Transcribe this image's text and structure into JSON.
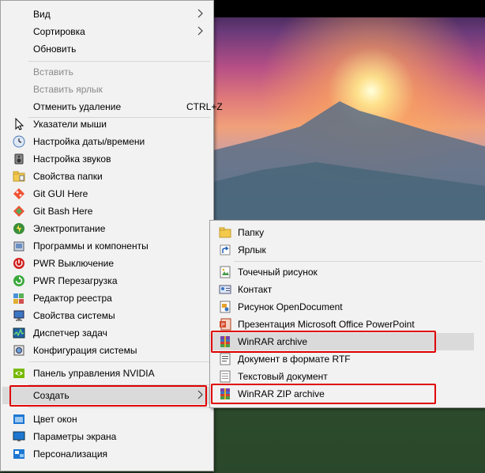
{
  "colors": {
    "menu_bg": "#f2f2f2",
    "hover_bg": "#dadada",
    "highlight_border": "#e00000",
    "disabled_text": "#8a8a8a"
  },
  "context_menu": {
    "items": [
      {
        "label": "Вид",
        "has_submenu": true
      },
      {
        "label": "Сортировка",
        "has_submenu": true
      },
      {
        "label": "Обновить"
      },
      {
        "label": "Вставить",
        "disabled": true
      },
      {
        "label": "Вставить ярлык",
        "disabled": true
      },
      {
        "label": "Отменить удаление",
        "shortcut": "CTRL+Z"
      },
      {
        "label": "Указатели мыши",
        "icon": "mouse-pointer-icon"
      },
      {
        "label": "Настройка даты/времени",
        "icon": "clock-icon"
      },
      {
        "label": "Настройка звуков",
        "icon": "speaker-icon"
      },
      {
        "label": "Свойства папки",
        "icon": "folder-options-icon"
      },
      {
        "label": "Git GUI Here",
        "icon": "git-gui-icon"
      },
      {
        "label": "Git Bash Here",
        "icon": "git-bash-icon"
      },
      {
        "label": "Электропитание",
        "icon": "power-options-icon"
      },
      {
        "label": "Программы и компоненты",
        "icon": "programs-icon"
      },
      {
        "label": "PWR Выключение",
        "icon": "shutdown-icon"
      },
      {
        "label": "PWR Перезагрузка",
        "icon": "restart-icon"
      },
      {
        "label": "Редактор реестра",
        "icon": "registry-editor-icon"
      },
      {
        "label": "Свойства системы",
        "icon": "system-properties-icon"
      },
      {
        "label": "Диспетчер задач",
        "icon": "task-manager-icon"
      },
      {
        "label": "Конфигурация системы",
        "icon": "msconfig-icon"
      },
      {
        "label": "Панель управления NVIDIA",
        "icon": "nvidia-icon"
      },
      {
        "label": "Создать",
        "has_submenu": true,
        "highlighted": true
      },
      {
        "label": "Цвет окон",
        "icon": "window-color-icon"
      },
      {
        "label": "Параметры экрана",
        "icon": "display-settings-icon"
      },
      {
        "label": "Персонализация",
        "icon": "personalization-icon"
      }
    ]
  },
  "submenu_create": {
    "items": [
      {
        "label": "Папку",
        "icon": "folder-icon"
      },
      {
        "label": "Ярлык",
        "icon": "shortcut-icon"
      },
      {
        "label": "Точечный рисунок",
        "icon": "bitmap-icon"
      },
      {
        "label": "Контакт",
        "icon": "contact-icon"
      },
      {
        "label": "Рисунок OpenDocument",
        "icon": "odg-drawing-icon"
      },
      {
        "label": "Презентация Microsoft Office PowerPoint",
        "icon": "powerpoint-icon"
      },
      {
        "label": "WinRAR archive",
        "icon": "winrar-icon",
        "highlighted": true
      },
      {
        "label": "Документ в формате RTF",
        "icon": "rtf-document-icon"
      },
      {
        "label": "Текстовый документ",
        "icon": "text-document-icon"
      },
      {
        "label": "WinRAR ZIP archive",
        "icon": "winrar-zip-icon",
        "highlighted": true
      }
    ]
  }
}
